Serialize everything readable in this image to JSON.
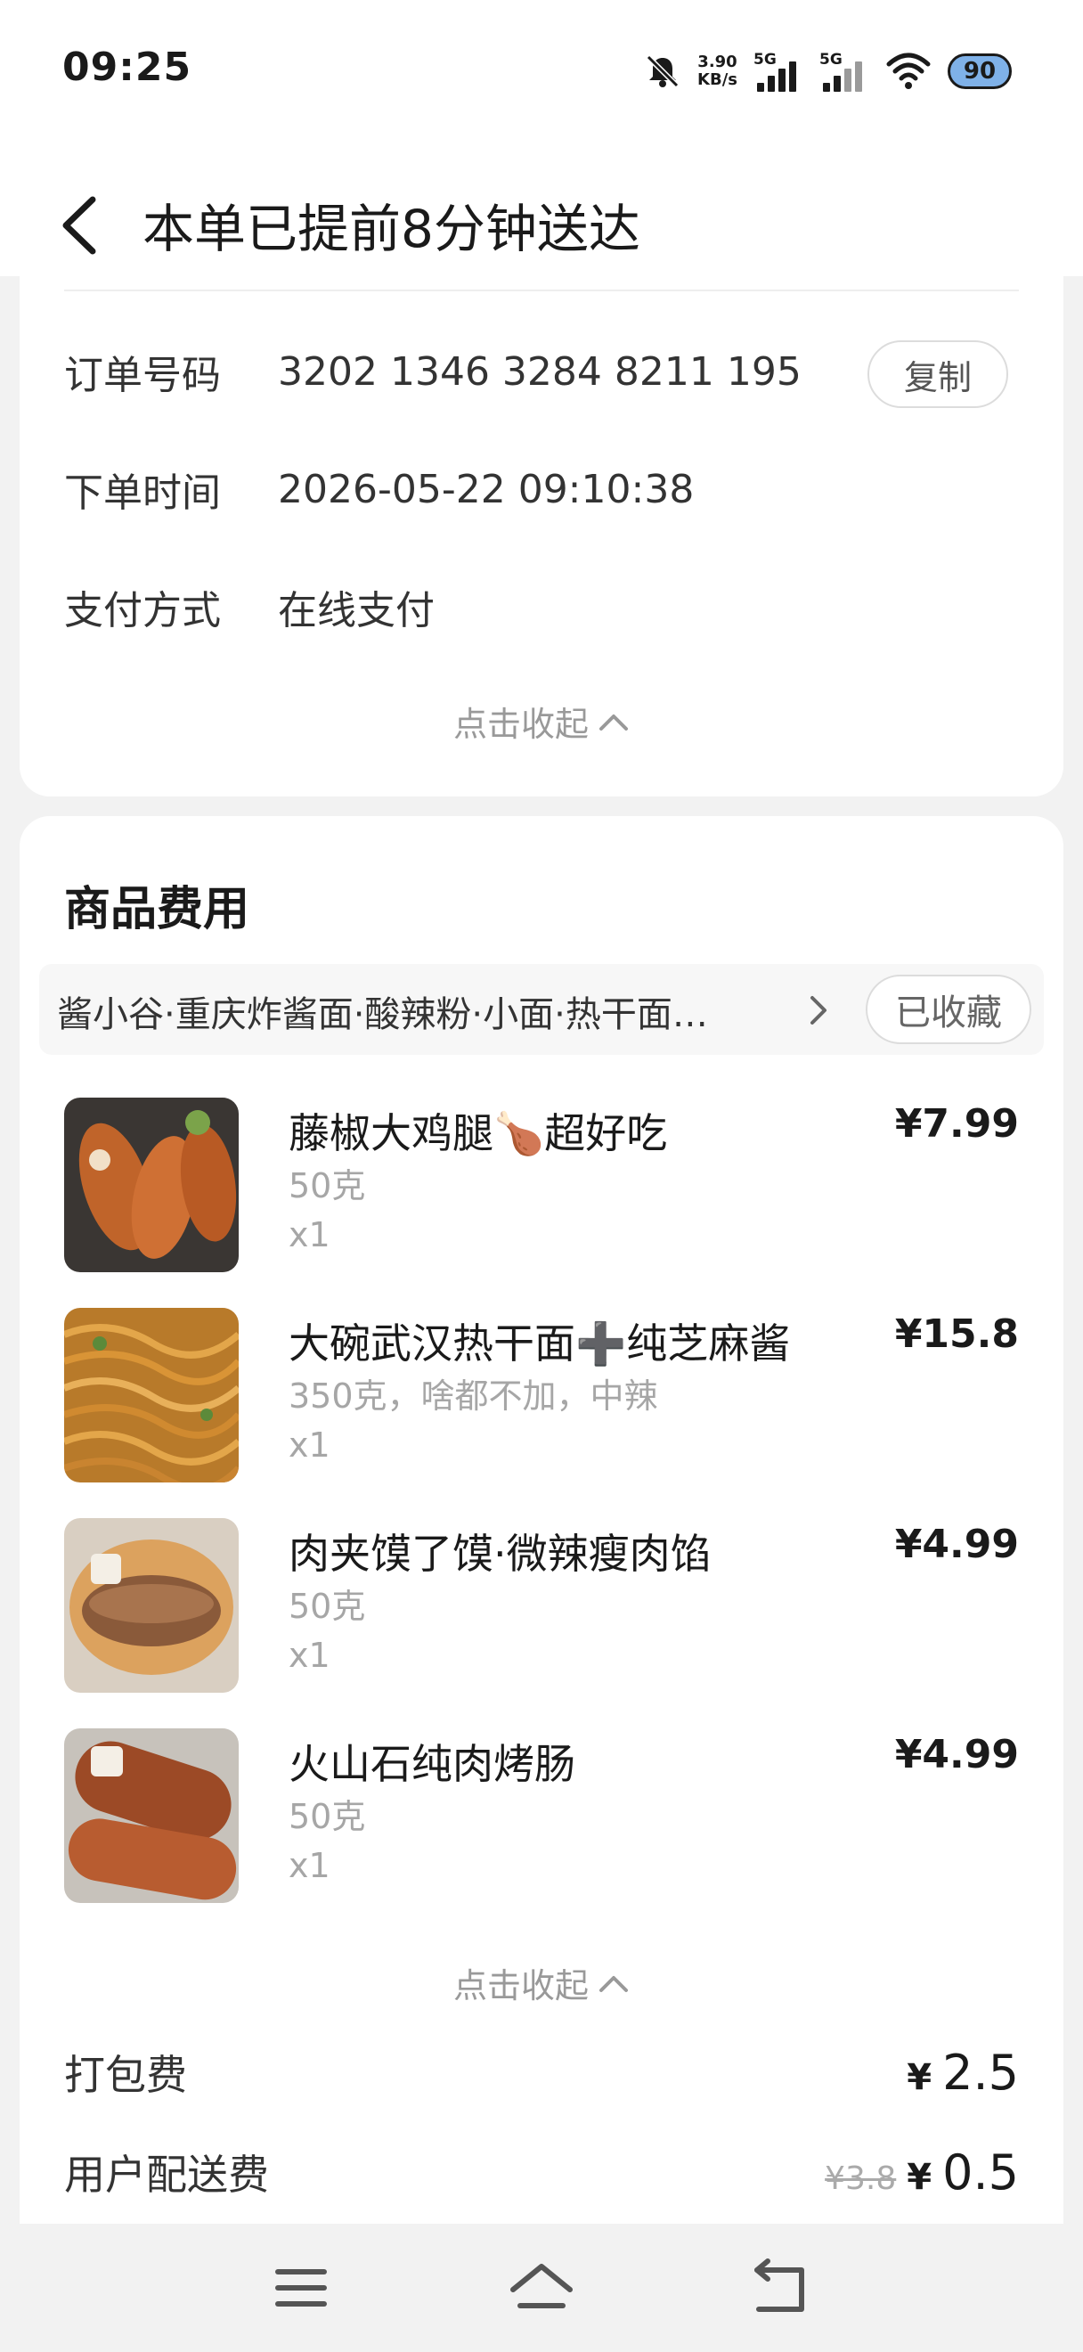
{
  "status_bar": {
    "time": "09:25",
    "net_speed_value": "3.90",
    "net_speed_unit": "KB/s",
    "sim1": "5G",
    "sim2": "5G",
    "battery": "90"
  },
  "header": {
    "title": "本单已提前8分钟送达"
  },
  "order_info": {
    "order_no_label": "订单号码",
    "order_no": "3202 1346 3284 8211 195",
    "copy_label": "复制",
    "time_label": "下单时间",
    "time_value": "2026-05-22 09:10:38",
    "pay_label": "支付方式",
    "pay_value": "在线支付",
    "collapse_label": "点击收起"
  },
  "goods": {
    "section_title": "商品费用",
    "shop_name": "酱小谷·重庆炸酱面·酸辣粉·小面·热干面…",
    "fav_label": "已收藏",
    "items": [
      {
        "name": "藤椒大鸡腿🍗超好吃",
        "spec": "50克",
        "qty": "x1",
        "price": "¥7.99"
      },
      {
        "name": "大碗武汉热干面➕纯芝麻酱",
        "spec": "350克，啥都不加，中辣",
        "qty": "x1",
        "price": "¥15.8"
      },
      {
        "name": "肉夹馍了馍·微辣瘦肉馅",
        "spec": "50克",
        "qty": "x1",
        "price": "¥4.99"
      },
      {
        "name": "火山石纯肉烤肠",
        "spec": "50克",
        "qty": "x1",
        "price": "¥4.99"
      }
    ],
    "collapse_label": "点击收起",
    "packing_fee_label": "打包费",
    "packing_fee_currency": "¥",
    "packing_fee": "2.5",
    "delivery_fee_label": "用户配送费",
    "delivery_fee_original": "¥3.8",
    "delivery_fee_currency": "¥",
    "delivery_fee": "0.5"
  },
  "icons": {
    "back": "back-arrow-icon",
    "mute": "bell-off-icon",
    "wifi": "wifi-icon",
    "collapse": "chevron-up-icon",
    "shop_more": "chevron-right-icon",
    "nav_menu": "menu-icon",
    "nav_home": "home-icon",
    "nav_back": "return-icon"
  }
}
